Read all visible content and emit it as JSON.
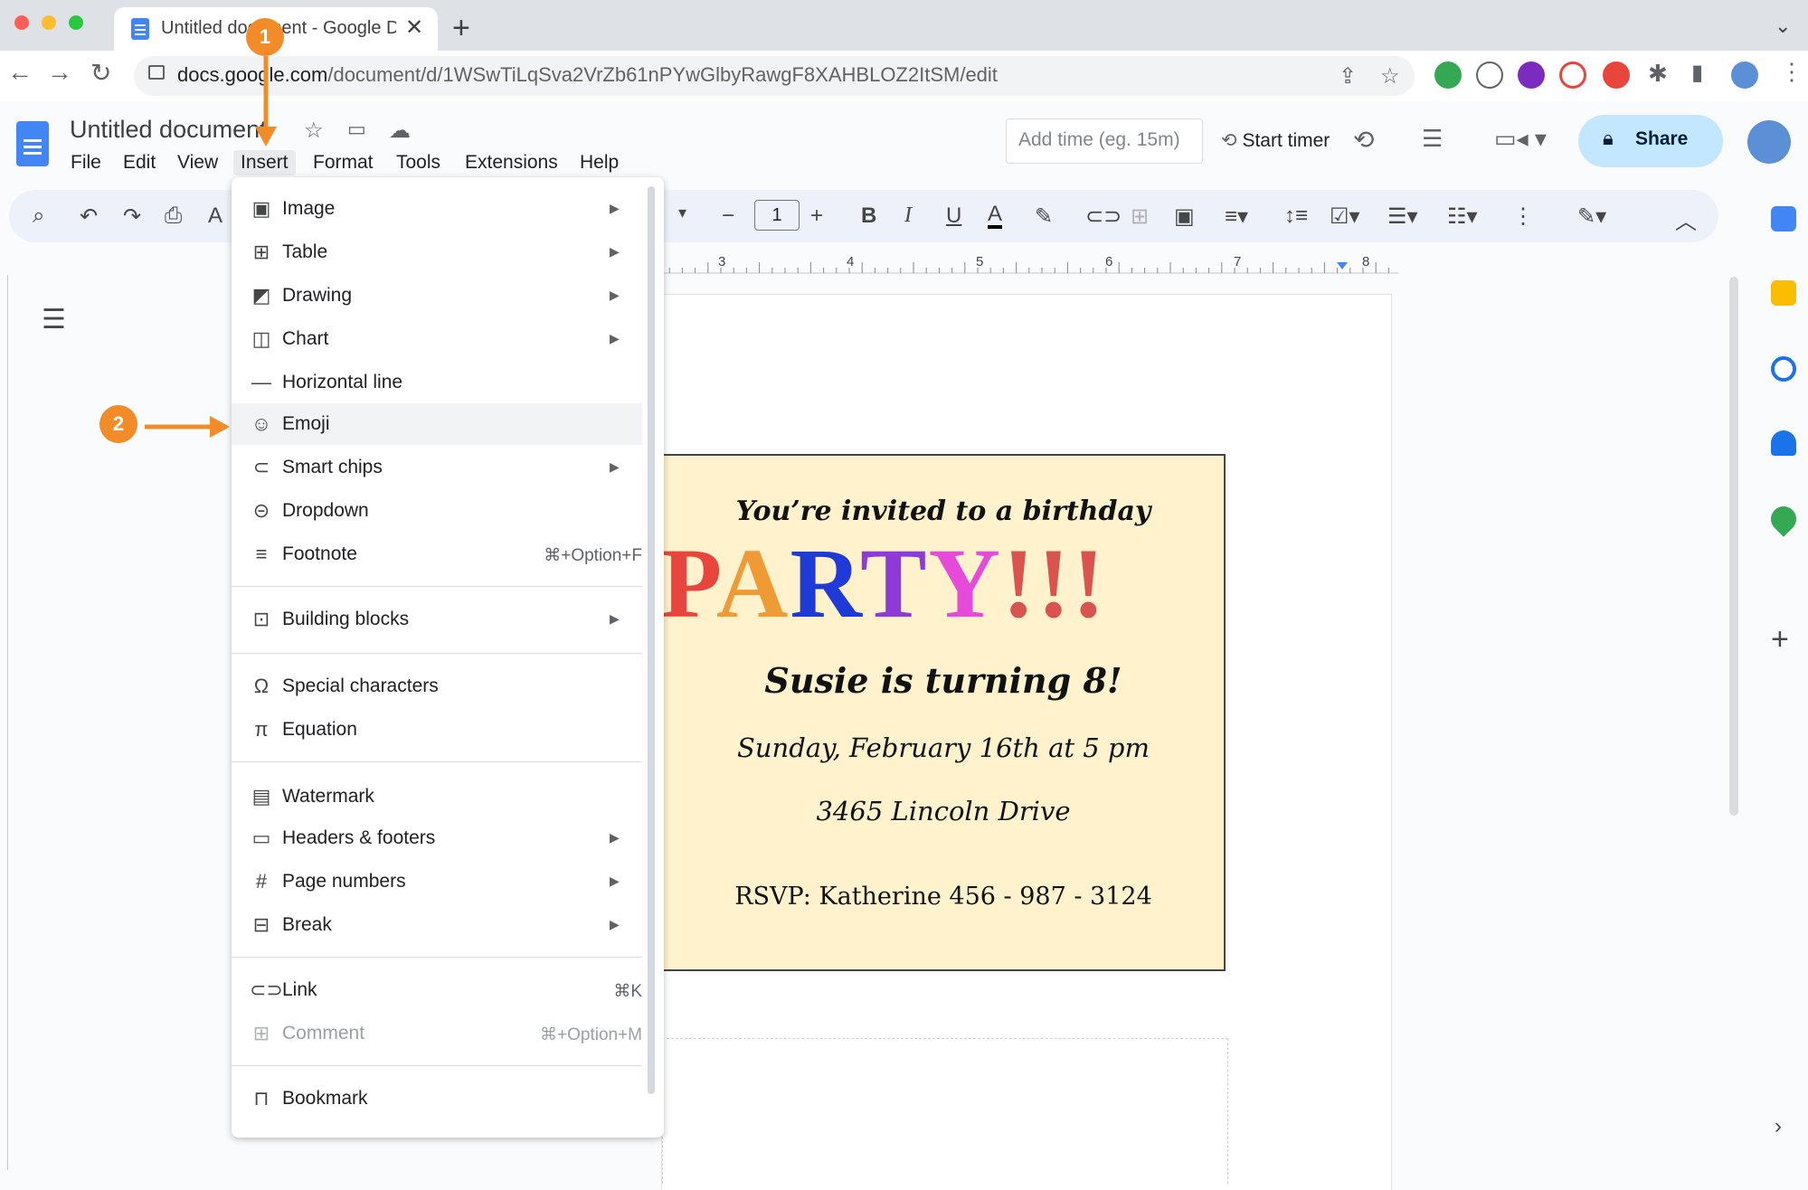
{
  "browser": {
    "tab_title": "Untitled document - Google Docs",
    "new_tab": "+",
    "url_host_prefix": "docs.goo",
    "url_host_suffix": "gle.com",
    "url_path": "/document/d/1WSwTiLqSva2VrZb61nPYwGlbyRawgF8XAHBLOZ2ItSM/edit",
    "icons": [
      "back-arrow-icon",
      "forward-arrow-icon",
      "reload-icon",
      "lock-icon",
      "share-page-icon",
      "bookmark-star-icon",
      "extensions-icon",
      "sidepanel-icon",
      "kebab-menu-icon"
    ]
  },
  "docs": {
    "title": "Untitled document",
    "menus": [
      "File",
      "Edit",
      "View",
      "Insert",
      "Format",
      "Tools",
      "Extensions",
      "Help"
    ],
    "add_time_placeholder": "Add time (eg. 15m)",
    "start_timer": "Start timer",
    "share_label": "Share",
    "font_size": "1",
    "ruler_ticks": [
      "3",
      "4",
      "5",
      "6",
      "7",
      "8"
    ]
  },
  "insert_menu": {
    "items": [
      {
        "label": "Image",
        "icon": "image-icon",
        "submenu": true
      },
      {
        "label": "Table",
        "icon": "table-icon",
        "submenu": true
      },
      {
        "label": "Drawing",
        "icon": "drawing-icon",
        "submenu": true
      },
      {
        "label": "Chart",
        "icon": "chart-icon",
        "submenu": true
      },
      {
        "label": "Horizontal line",
        "icon": "horizontal-line-icon",
        "submenu": false
      },
      {
        "label": "Emoji",
        "icon": "emoji-icon",
        "submenu": false
      },
      {
        "label": "Smart chips",
        "icon": "smart-chips-icon",
        "submenu": true
      },
      {
        "label": "Dropdown",
        "icon": "dropdown-icon",
        "submenu": false
      },
      {
        "label": "Footnote",
        "icon": "footnote-icon",
        "shortcut": "⌘+Option+F"
      },
      {
        "label": "Building blocks",
        "icon": "building-blocks-icon",
        "submenu": true
      },
      {
        "label": "Special characters",
        "icon": "omega-icon",
        "submenu": false
      },
      {
        "label": "Equation",
        "icon": "pi-icon",
        "submenu": false
      },
      {
        "label": "Watermark",
        "icon": "watermark-icon",
        "submenu": false
      },
      {
        "label": "Headers & footers",
        "icon": "headers-footers-icon",
        "submenu": true
      },
      {
        "label": "Page numbers",
        "icon": "hash-icon",
        "submenu": true
      },
      {
        "label": "Break",
        "icon": "break-icon",
        "submenu": true
      },
      {
        "label": "Link",
        "icon": "link-icon",
        "shortcut": "⌘K"
      },
      {
        "label": "Comment",
        "icon": "comment-icon",
        "shortcut": "⌘+Option+M",
        "disabled": true
      },
      {
        "label": "Bookmark",
        "icon": "bookmark-icon",
        "submenu": false
      }
    ]
  },
  "invitation": {
    "line1": "You’re invited to a birthday",
    "party_letters": [
      {
        "ch": "P",
        "color": "#e8453c"
      },
      {
        "ch": "A",
        "color": "#f09a36"
      },
      {
        "ch": "R",
        "color": "#1f3ad6"
      },
      {
        "ch": "T",
        "color": "#8e3ad6"
      },
      {
        "ch": "Y",
        "color": "#e64ad8"
      },
      {
        "ch": "!!!",
        "color": "#d9534f"
      }
    ],
    "line3": "Susie is turning 8!",
    "line4": "Sunday, February 16th at 5 pm",
    "line5": "3465 Lincoln Drive",
    "line6": "RSVP: Katherine 456 - 987 - 3124",
    "background": "#fff2cc"
  },
  "annotations": {
    "step1": "1",
    "step2": "2",
    "color": "#f28c28"
  }
}
